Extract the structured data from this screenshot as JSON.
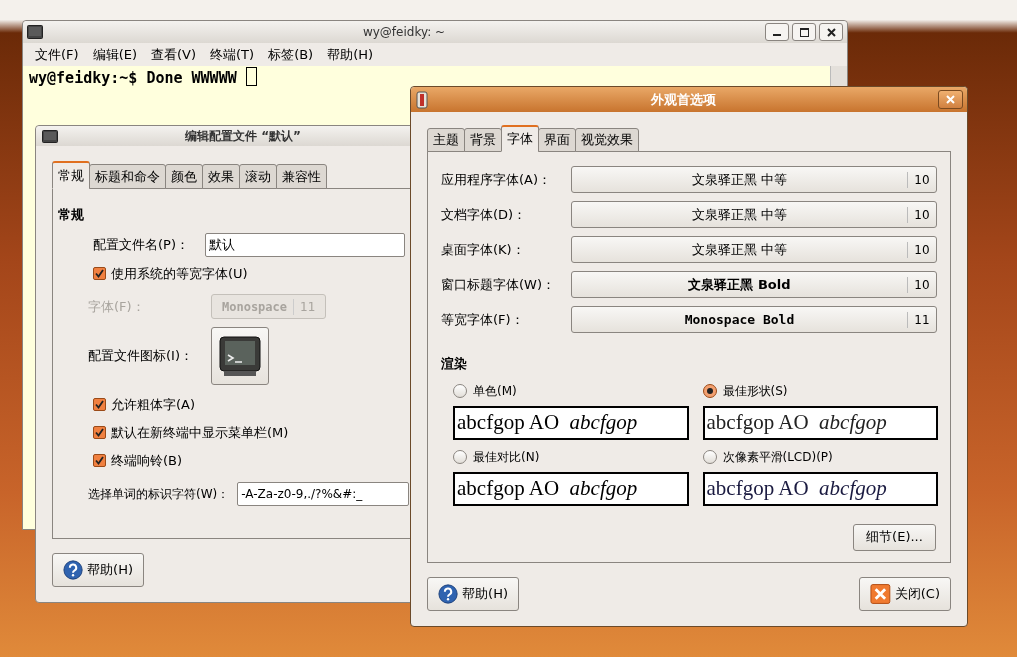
{
  "terminal": {
    "title": "wy@feidky: ~",
    "menu": [
      "文件(F)",
      "编辑(E)",
      "查看(V)",
      "终端(T)",
      "标签(B)",
      "帮助(H)"
    ],
    "line": "wy@feidky:~$ Done WWWWW"
  },
  "profile_dialog": {
    "title": "编辑配置文件 “默认”",
    "tabs": [
      {
        "label": "常规",
        "selected": true
      },
      {
        "label": "标题和命令",
        "selected": false
      },
      {
        "label": "颜色",
        "selected": false
      },
      {
        "label": "效果",
        "selected": false
      },
      {
        "label": "滚动",
        "selected": false
      },
      {
        "label": "兼容性",
        "selected": false
      }
    ],
    "section_title": "常规",
    "profile_name": {
      "label": "配置文件名(P)：",
      "value": "默认"
    },
    "use_system_font": {
      "label": "使用系统的等宽字体(U)",
      "checked": true
    },
    "font": {
      "label": "字体(F)：",
      "name": "Monospace",
      "size": "11",
      "disabled": true
    },
    "icon_label": "配置文件图标(I)：",
    "options": [
      {
        "label": "允许粗体字(A)",
        "checked": true
      },
      {
        "label": "默认在新终端中显示菜单栏(M)",
        "checked": true
      },
      {
        "label": "终端响铃(B)",
        "checked": true
      }
    ],
    "word_chars": {
      "label": "选择单词的标识字符(W)：",
      "value": "-A-Za-z0-9,./?%&#:_"
    },
    "help_button": "帮助(H)"
  },
  "appearance_dialog": {
    "title": "外观首选项",
    "tabs": [
      {
        "label": "主题",
        "selected": false
      },
      {
        "label": "背景",
        "selected": false
      },
      {
        "label": "字体",
        "selected": true
      },
      {
        "label": "界面",
        "selected": false
      },
      {
        "label": "视觉效果",
        "selected": false
      }
    ],
    "fonts": [
      {
        "label": "应用程序字体(A)：",
        "font": "文泉驿正黑 中等",
        "size": "10",
        "bold": false,
        "monospace": false
      },
      {
        "label": "文档字体(D)：",
        "font": "文泉驿正黑 中等",
        "size": "10",
        "bold": false,
        "monospace": false
      },
      {
        "label": "桌面字体(K)：",
        "font": "文泉驿正黑 中等",
        "size": "10",
        "bold": false,
        "monospace": false
      },
      {
        "label": "窗口标题字体(W)：",
        "font": "文泉驿正黑 Bold",
        "size": "10",
        "bold": true,
        "monospace": false
      },
      {
        "label": "等宽字体(F)：",
        "font": "Monospace Bold",
        "size": "11",
        "bold": true,
        "monospace": true
      }
    ],
    "rendering_title": "渲染",
    "rendering": [
      {
        "label": "单色(M)",
        "selected": false,
        "sample": "abcfgop AO",
        "sample_italic": "abcfgop"
      },
      {
        "label": "最佳形状(S)",
        "selected": true,
        "sample": "abcfgop AO",
        "sample_italic": "abcfgop"
      },
      {
        "label": "最佳对比(N)",
        "selected": false,
        "sample": "abcfgop AO",
        "sample_italic": "abcfgop"
      },
      {
        "label": "次像素平滑(LCD)(P)",
        "selected": false,
        "sample": "abcfgop AO",
        "sample_italic": "abcfgop"
      }
    ],
    "details_button": "细节(E)...",
    "help_button": "帮助(H)",
    "close_button": "关闭(C)"
  }
}
